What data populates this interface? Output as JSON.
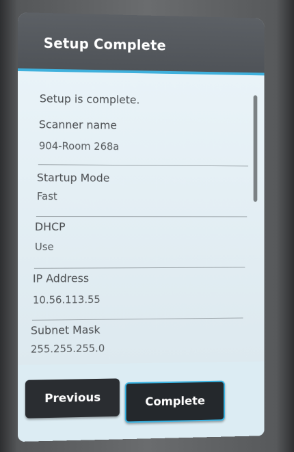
{
  "header": {
    "title": "Setup Complete"
  },
  "content": {
    "status": "Setup is complete.",
    "fields": [
      {
        "label": "Scanner name",
        "value": "904-Room 268a"
      },
      {
        "label": "Startup Mode",
        "value": "Fast"
      },
      {
        "label": "DHCP",
        "value": "Use"
      },
      {
        "label": "IP Address",
        "value": "10.56.113.55"
      },
      {
        "label": "Subnet Mask",
        "value": "255.255.255.0"
      }
    ]
  },
  "footer": {
    "previous_label": "Previous",
    "complete_label": "Complete"
  },
  "colors": {
    "accent": "#3fb0dc",
    "header_bg": "#4f5358",
    "button_bg": "#2a2d31"
  }
}
